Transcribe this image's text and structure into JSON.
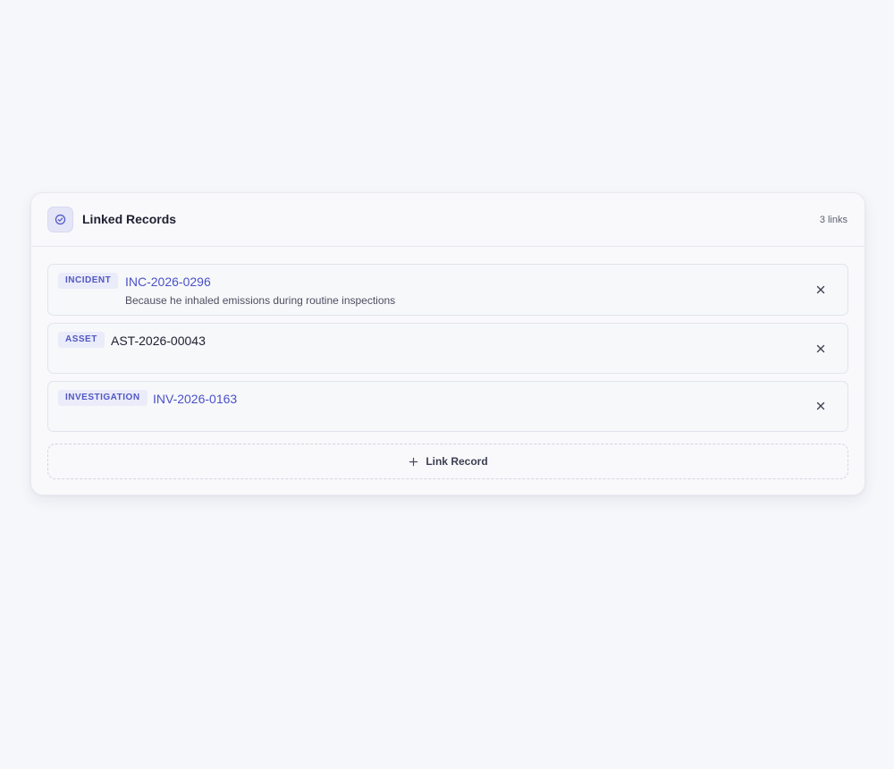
{
  "panel": {
    "title": "Linked Records",
    "count_label": "3 links",
    "header_icon": "check-circle-icon"
  },
  "records": [
    {
      "type": "INCIDENT",
      "id": "INC-2026-0296",
      "description": "Because he inhaled emissions during routine inspections",
      "is_link": true
    },
    {
      "type": "ASSET",
      "id": "AST-2026-00043",
      "description": "",
      "is_link": false
    },
    {
      "type": "INVESTIGATION",
      "id": "INV-2026-0163",
      "description": "",
      "is_link": true
    }
  ],
  "add_button": {
    "label": "Link Record",
    "icon": "plus-icon"
  },
  "colors": {
    "accent": "#4a51c8",
    "badge_bg": "#ebecfa",
    "page_bg": "#f6f7fb"
  }
}
